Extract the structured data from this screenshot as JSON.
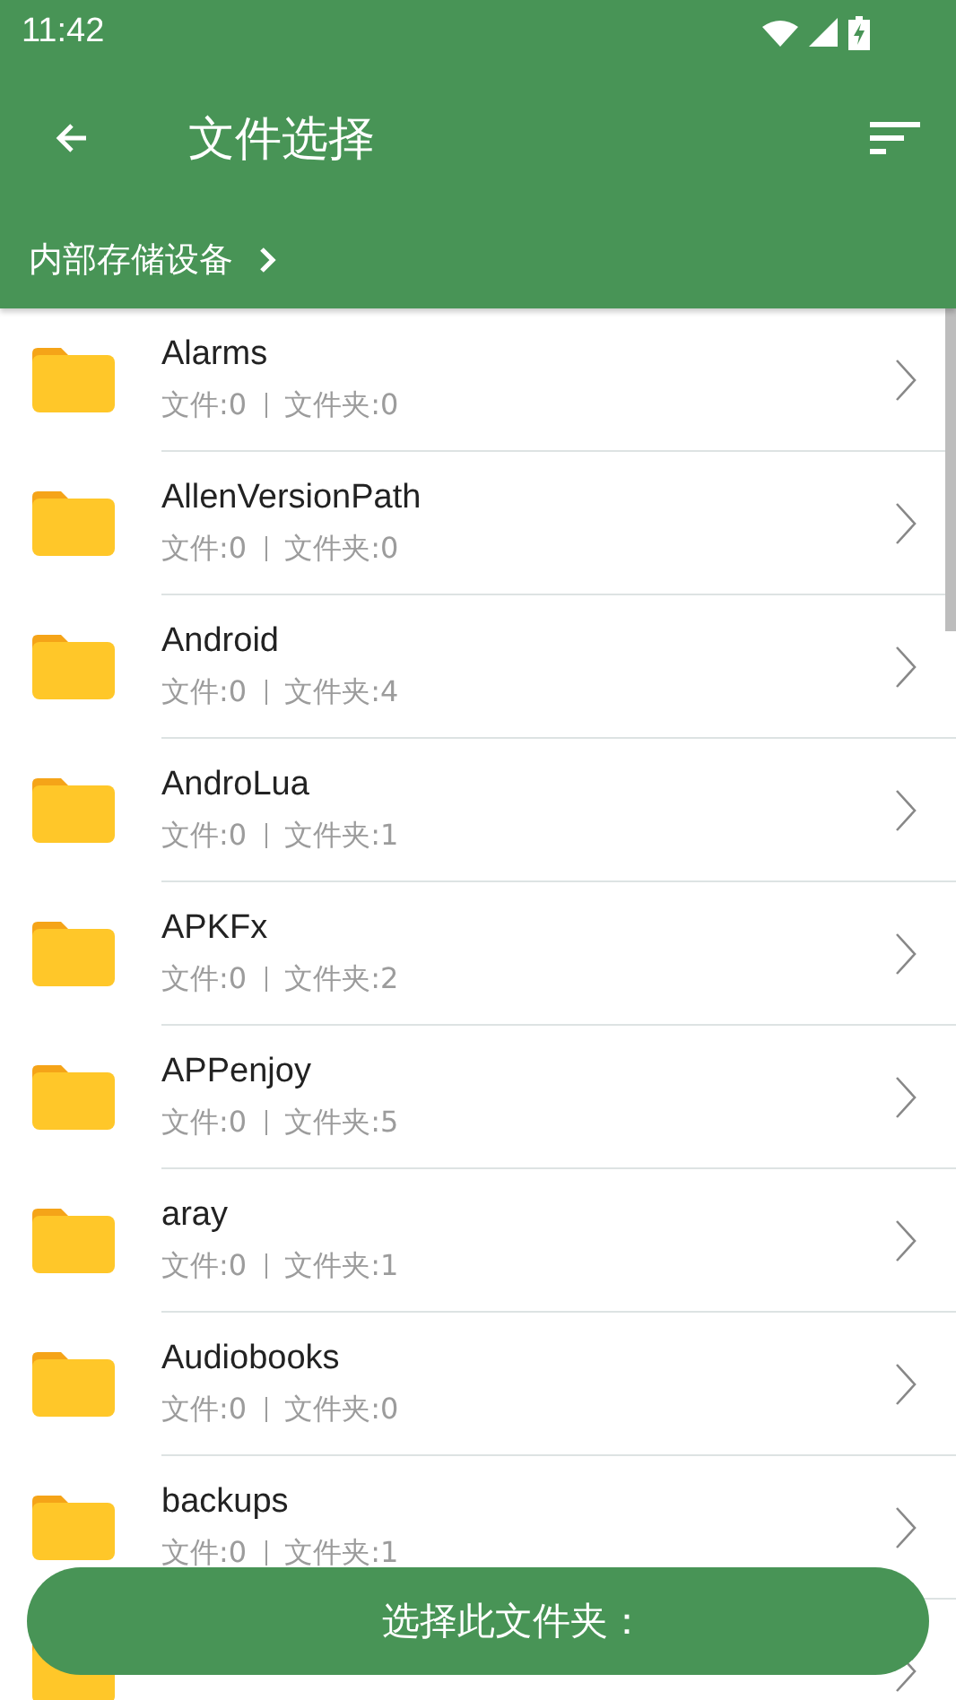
{
  "status_bar": {
    "time": "11:42"
  },
  "toolbar": {
    "title": "文件选择"
  },
  "breadcrumb": {
    "items": [
      "内部存储设备"
    ]
  },
  "folders": [
    {
      "name": "Alarms",
      "files": "文件:0",
      "folders": "文件夹:0"
    },
    {
      "name": "AllenVersionPath",
      "files": "文件:0",
      "folders": "文件夹:0"
    },
    {
      "name": "Android",
      "files": "文件:0",
      "folders": "文件夹:4"
    },
    {
      "name": "AndroLua",
      "files": "文件:0",
      "folders": "文件夹:1"
    },
    {
      "name": "APKFx",
      "files": "文件:0",
      "folders": "文件夹:2"
    },
    {
      "name": "APPenjoy",
      "files": "文件:0",
      "folders": "文件夹:5"
    },
    {
      "name": "aray",
      "files": "文件:0",
      "folders": "文件夹:1"
    },
    {
      "name": "Audiobooks",
      "files": "文件:0",
      "folders": "文件夹:0"
    },
    {
      "name": "backups",
      "files": "文件:0",
      "folders": "文件夹:1"
    },
    {
      "kind": "partial"
    }
  ],
  "select_button": {
    "label": "选择此文件夹："
  }
}
